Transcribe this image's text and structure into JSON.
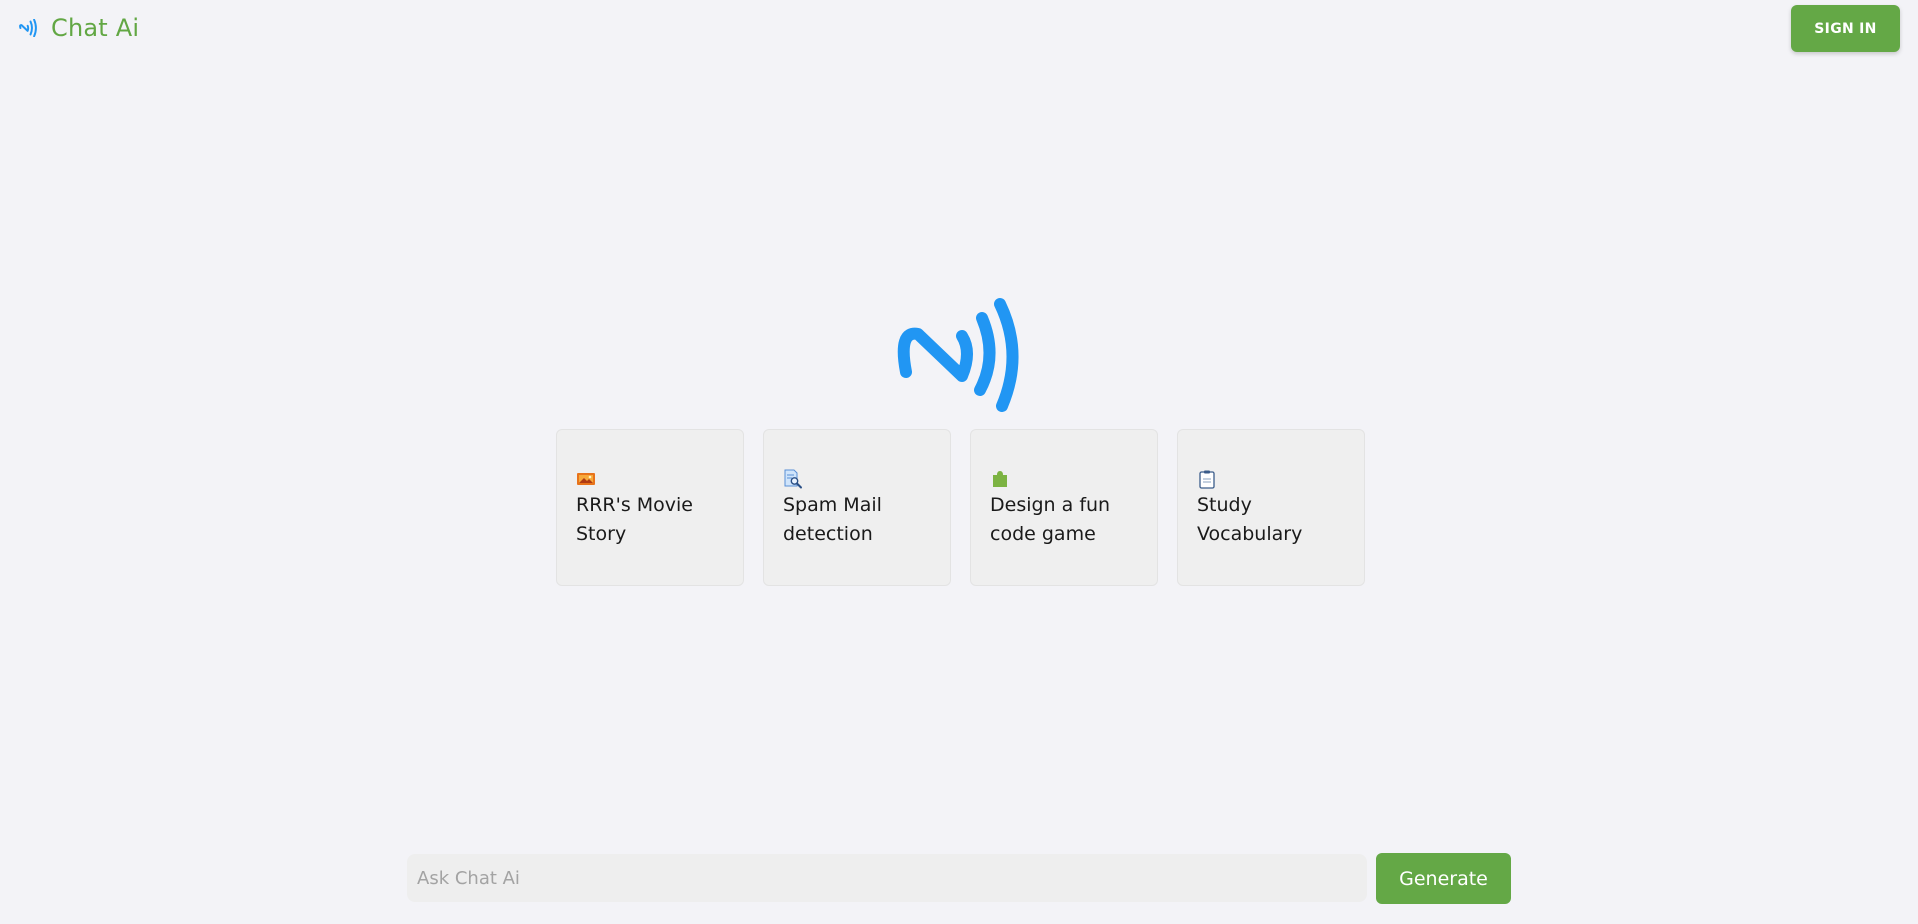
{
  "header": {
    "brand_name": "Chat Ai",
    "logo_icon": "nfc-wave-icon",
    "signin_label": "SIGN IN"
  },
  "colors": {
    "brand_green": "#64a846",
    "logo_blue": "#2196f3",
    "background": "#f3f3f7"
  },
  "hero": {
    "logo_icon": "nfc-wave-icon"
  },
  "suggestions": [
    {
      "icon": "movie-frame-icon",
      "text": "RRR's Movie Story"
    },
    {
      "icon": "document-search-icon",
      "text": "Spam Mail detection"
    },
    {
      "icon": "puzzle-piece-icon",
      "text": "Design a fun code game"
    },
    {
      "icon": "clipboard-icon",
      "text": "Study Vocabulary"
    }
  ],
  "prompt": {
    "placeholder": "Ask Chat Ai",
    "value": "",
    "generate_label": "Generate"
  }
}
